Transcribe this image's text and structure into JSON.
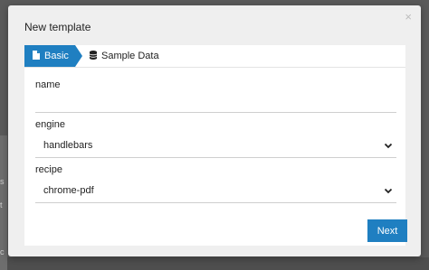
{
  "modal": {
    "title": "New template",
    "close_glyph": "×"
  },
  "tabs": [
    {
      "label": "Basic",
      "icon": "file-icon",
      "active": true
    },
    {
      "label": "Sample Data",
      "icon": "database-icon",
      "active": false
    }
  ],
  "form": {
    "name": {
      "label": "name",
      "value": ""
    },
    "engine": {
      "label": "engine",
      "value": "handlebars"
    },
    "recipe": {
      "label": "recipe",
      "value": "chrome-pdf"
    }
  },
  "footer": {
    "next_label": "Next"
  },
  "background": {
    "fragments": [
      "s",
      "t",
      "c"
    ]
  },
  "colors": {
    "accent": "#1f7fc1",
    "modal_bg": "#efefef",
    "overlay": "#5a5a5a"
  }
}
